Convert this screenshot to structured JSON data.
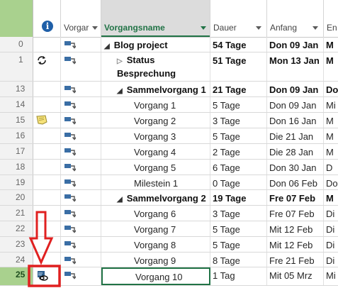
{
  "header": {
    "columns": {
      "mode": "Vorgar",
      "name": "Vorgangsname",
      "duration": "Dauer",
      "start": "Anfang",
      "finish": "En"
    },
    "info_icon": "info-icon"
  },
  "rows": [
    {
      "num": "0",
      "name": "Blog project",
      "dur": "54 Tage",
      "start": "Don 09 Jan",
      "fin": "M",
      "level": 0,
      "summary": true,
      "toggle": "expanded",
      "indicator": ""
    },
    {
      "num": "1",
      "name": "Status Besprechung",
      "dur": "51 Tage",
      "start": "Mon 13 Jan",
      "fin": "M",
      "level": 1,
      "summary": true,
      "toggle": "collapsed",
      "indicator": "recurring-icon"
    },
    {
      "num": "13",
      "name": "Sammelvorgang 1",
      "dur": "21 Tage",
      "start": "Don 09 Jan",
      "fin": "Do",
      "level": 1,
      "summary": true,
      "toggle": "expanded",
      "indicator": ""
    },
    {
      "num": "14",
      "name": "Vorgang 1",
      "dur": "5 Tage",
      "start": "Don 09 Jan",
      "fin": "Mi",
      "level": 2,
      "summary": false,
      "toggle": "",
      "indicator": ""
    },
    {
      "num": "15",
      "name": "Vorgang 2",
      "dur": "3 Tage",
      "start": "Don 16 Jan",
      "fin": "M",
      "level": 2,
      "summary": false,
      "toggle": "",
      "indicator": "note-icon"
    },
    {
      "num": "16",
      "name": "Vorgang 3",
      "dur": "5 Tage",
      "start": "Die 21 Jan",
      "fin": "M",
      "level": 2,
      "summary": false,
      "toggle": "",
      "indicator": ""
    },
    {
      "num": "17",
      "name": "Vorgang 4",
      "dur": "2 Tage",
      "start": "Die 28 Jan",
      "fin": "M",
      "level": 2,
      "summary": false,
      "toggle": "",
      "indicator": ""
    },
    {
      "num": "18",
      "name": "Vorgang 5",
      "dur": "6 Tage",
      "start": "Don 30 Jan",
      "fin": "D",
      "level": 2,
      "summary": false,
      "toggle": "",
      "indicator": ""
    },
    {
      "num": "19",
      "name": "Milestein 1",
      "dur": "0 Tage",
      "start": "Don 06 Feb",
      "fin": "Do",
      "level": 2,
      "summary": false,
      "toggle": "",
      "indicator": ""
    },
    {
      "num": "20",
      "name": "Sammelvorgang 2",
      "dur": "19 Tage",
      "start": "Fre 07 Feb",
      "fin": "M",
      "level": 1,
      "summary": true,
      "toggle": "expanded",
      "indicator": ""
    },
    {
      "num": "21",
      "name": "Vorgang 6",
      "dur": "3 Tage",
      "start": "Fre 07 Feb",
      "fin": "Di",
      "level": 2,
      "summary": false,
      "toggle": "",
      "indicator": ""
    },
    {
      "num": "22",
      "name": "Vorgang 7",
      "dur": "5 Tage",
      "start": "Mit 12 Feb",
      "fin": "Di",
      "level": 2,
      "summary": false,
      "toggle": "",
      "indicator": ""
    },
    {
      "num": "23",
      "name": "Vorgang 8",
      "dur": "5 Tage",
      "start": "Mit 12 Feb",
      "fin": "Di",
      "level": 2,
      "summary": false,
      "toggle": "",
      "indicator": ""
    },
    {
      "num": "24",
      "name": "Vorgang 9",
      "dur": "8 Tage",
      "start": "Fre 21 Feb",
      "fin": "Di",
      "level": 2,
      "summary": false,
      "toggle": "",
      "indicator": ""
    },
    {
      "num": "25",
      "name": "Vorgang 10",
      "dur": "1 Tag",
      "start": "Mit 05 Mrz",
      "fin": "Mi",
      "level": 2,
      "summary": false,
      "toggle": "",
      "indicator": "linked-task-icon",
      "selected": true
    }
  ],
  "annotation": {
    "arrow_color": "#e02020",
    "highlight_color": "#e02020"
  },
  "colors": {
    "accent_green": "#217346",
    "selected_row_number_bg": "#a9d18e",
    "mode_icon_blue": "#3a6ea5"
  }
}
